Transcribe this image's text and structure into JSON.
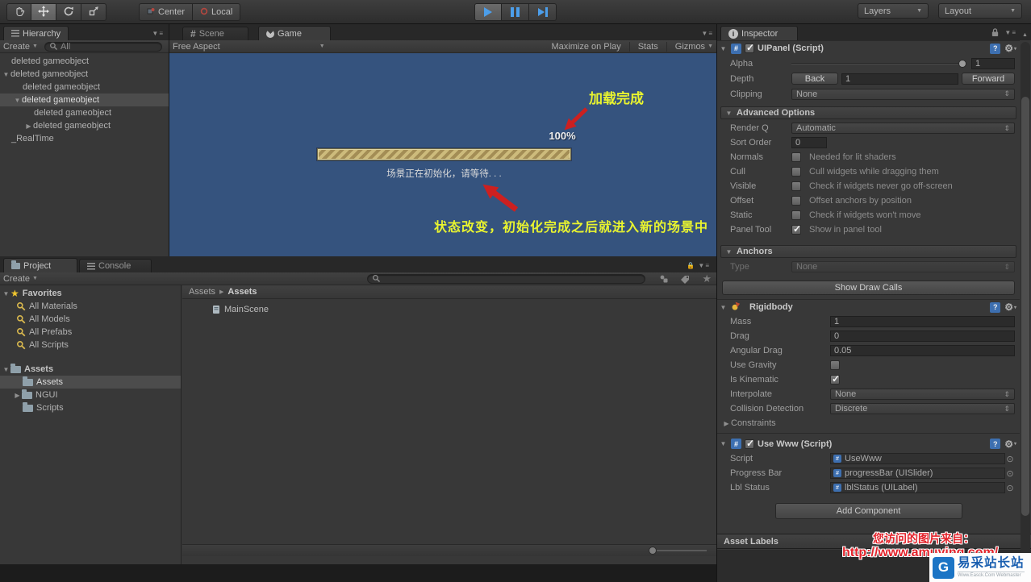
{
  "toolbar": {
    "pivot": "Center",
    "space": "Local",
    "layers": "Layers",
    "layout": "Layout"
  },
  "hierarchy": {
    "tab": "Hierarchy",
    "create": "Create",
    "search_filter": "All",
    "items": [
      {
        "label": "deleted gameobject"
      },
      {
        "label": "deleted gameobject"
      },
      {
        "label": "deleted gameobject"
      },
      {
        "label": "deleted gameobject"
      },
      {
        "label": "deleted gameobject"
      },
      {
        "label": "deleted gameobject"
      },
      {
        "label": "_RealTime"
      }
    ]
  },
  "game": {
    "scene_tab": "Scene",
    "game_tab": "Game",
    "aspect": "Free Aspect",
    "maximize": "Maximize on Play",
    "stats": "Stats",
    "gizmos": "Gizmos",
    "annotation_top": "加载完成",
    "percent": "100%",
    "status": "场景正在初始化，请等待. . .",
    "annotation_bottom": "状态改变，初始化完成之后就进入新的场景中"
  },
  "project": {
    "tab": "Project",
    "console_tab": "Console",
    "create": "Create",
    "favorites_label": "Favorites",
    "favorites": [
      "All Materials",
      "All Models",
      "All Prefabs",
      "All Scripts"
    ],
    "assets_root": "Assets",
    "folders": [
      {
        "label": "Assets"
      },
      {
        "label": "NGUI"
      },
      {
        "label": "Scripts"
      }
    ],
    "breadcrumb": [
      "Assets",
      "Assets"
    ],
    "files": [
      "MainScene"
    ]
  },
  "inspector": {
    "tab": "Inspector",
    "uipanel": {
      "title": "UIPanel (Script)",
      "alpha_label": "Alpha",
      "alpha_value": "1",
      "depth_label": "Depth",
      "back": "Back",
      "depth_value": "1",
      "forward": "Forward",
      "clipping_label": "Clipping",
      "clipping_value": "None"
    },
    "advanced": {
      "title": "Advanced Options",
      "render_q_label": "Render Q",
      "render_q_value": "Automatic",
      "sort_order_label": "Sort Order",
      "sort_order_value": "0",
      "rows": [
        {
          "label": "Normals",
          "desc": "Needed for lit shaders",
          "checked": false
        },
        {
          "label": "Cull",
          "desc": "Cull widgets while dragging them",
          "checked": false
        },
        {
          "label": "Visible",
          "desc": "Check if widgets never go off-screen",
          "checked": false
        },
        {
          "label": "Offset",
          "desc": "Offset anchors by position",
          "checked": false
        },
        {
          "label": "Static",
          "desc": "Check if widgets won't move",
          "checked": false
        },
        {
          "label": "Panel Tool",
          "desc": "Show in panel tool",
          "checked": true
        }
      ]
    },
    "anchors": {
      "title": "Anchors",
      "type_label": "Type",
      "type_value": "None"
    },
    "show_draw_calls": "Show Draw Calls",
    "rigidbody": {
      "title": "Rigidbody",
      "mass_label": "Mass",
      "mass_value": "1",
      "drag_label": "Drag",
      "drag_value": "0",
      "angular_drag_label": "Angular Drag",
      "angular_drag_value": "0.05",
      "use_gravity_label": "Use Gravity",
      "use_gravity_checked": false,
      "is_kinematic_label": "Is Kinematic",
      "is_kinematic_checked": true,
      "interpolate_label": "Interpolate",
      "interpolate_value": "None",
      "collision_label": "Collision Detection",
      "collision_value": "Discrete",
      "constraints": "Constraints"
    },
    "usewww": {
      "title": "Use Www (Script)",
      "rows": [
        {
          "label": "Script",
          "value": "UseWww"
        },
        {
          "label": "Progress Bar",
          "value": "progressBar (UISlider)"
        },
        {
          "label": "Lbl Status",
          "value": "lblStatus (UILabel)"
        }
      ]
    },
    "add_component": "Add Component",
    "asset_labels": "Asset Labels"
  },
  "watermark": {
    "line1": "您访问的图片来自：",
    "line2": "http://www.amuying.com/",
    "logo_text": "易采站长站",
    "logo_sub": "Www.Easck.Com Webmaster"
  },
  "colors": {
    "game_bg": "#35537E",
    "annotation_yellow": "#E9F42F",
    "arrow_red": "#CC2020",
    "progress_fill": "#C9B878",
    "watermark_red": "#E3232B",
    "logo_blue": "#1B74C5"
  }
}
